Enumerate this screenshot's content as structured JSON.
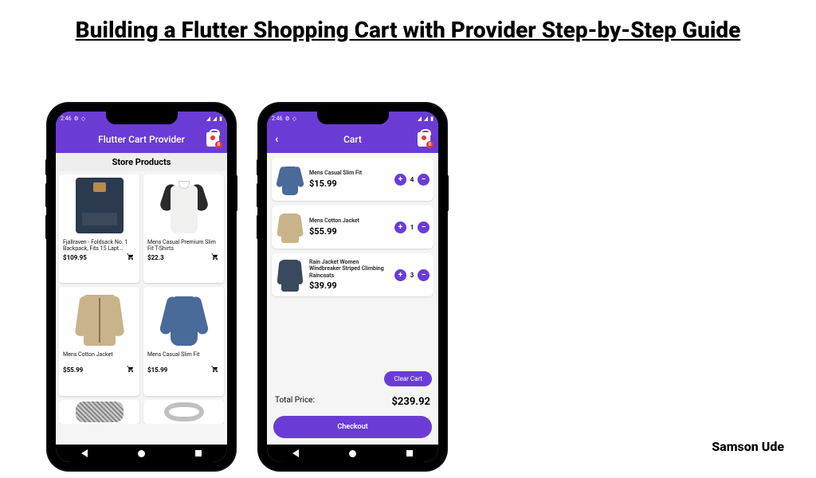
{
  "page_title": "Building a Flutter Shopping Cart with Provider Step-by-Step Guide",
  "author": "Samson Ude",
  "status": {
    "time": "2:46",
    "icons": "▾◆▮"
  },
  "colors": {
    "primary": "#6a3cd5",
    "accent": "#e53935"
  },
  "phone1": {
    "app_title": "Flutter Cart Provider",
    "cart_count": "8",
    "section_header": "Store Products",
    "products": [
      {
        "name": "Fjallraven - Foldsack No. 1 Backpack, Fits 15 Lapt...",
        "price": "$109.95"
      },
      {
        "name": "Mens Casual Premium Slim Fit T-Shirts",
        "price": "$22.3"
      },
      {
        "name": "Mens Cotton Jacket",
        "price": "$55.99"
      },
      {
        "name": "Mens Casual Slim Fit",
        "price": "$15.99"
      }
    ]
  },
  "phone2": {
    "app_title": "Cart",
    "cart_count": "8",
    "items": [
      {
        "name": "Mens Casual Slim Fit",
        "price": "$15.99",
        "qty": "4"
      },
      {
        "name": "Mens Cotton Jacket",
        "price": "$55.99",
        "qty": "1"
      },
      {
        "name": "Rain Jacket Women Windbreaker Striped Climbing Raincoats",
        "price": "$39.99",
        "qty": "3"
      }
    ],
    "clear_label": "Clear Cart",
    "total_label": "Total Price:",
    "total_value": "$239.92",
    "checkout_label": "Checkout"
  }
}
